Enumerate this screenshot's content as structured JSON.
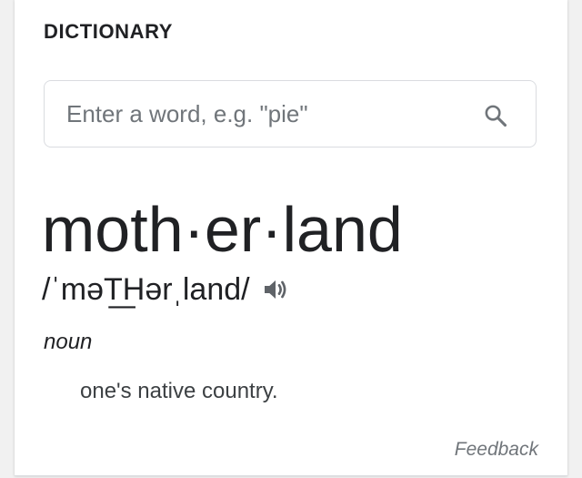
{
  "card": {
    "title": "DICTIONARY"
  },
  "search": {
    "placeholder": "Enter a word, e.g. \"pie\"",
    "icon": "search-icon"
  },
  "entry": {
    "headword": "moth·er·land",
    "pronunciation": "/ˈməT͟Hərˌland/",
    "audio_icon": "speaker-icon",
    "part_of_speech": "noun",
    "definition": "one's native country."
  },
  "footer": {
    "feedback_label": "Feedback"
  },
  "colors": {
    "text_primary": "#202124",
    "text_secondary": "#70757a",
    "border": "#dadce0",
    "background": "#f1f1f1"
  }
}
